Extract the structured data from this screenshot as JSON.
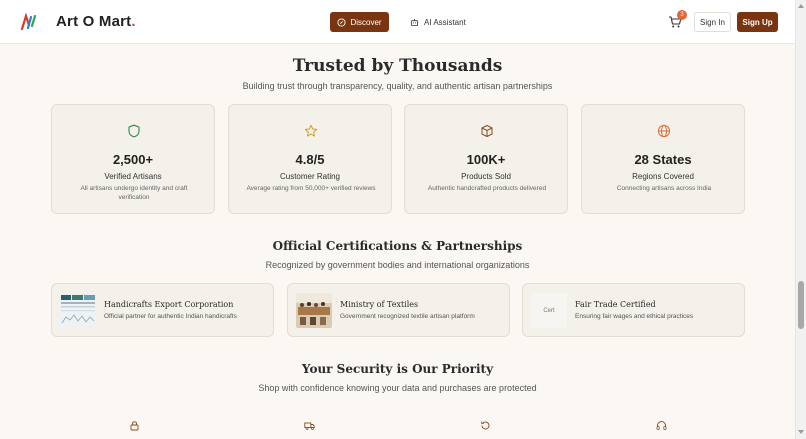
{
  "header": {
    "logo_text": "Art O Mart",
    "logo_dot": ".",
    "nav": {
      "discover_label": "Discover",
      "ai_assistant_label": "AI Assistant"
    },
    "cart_count": "3",
    "sign_in_label": "Sign In",
    "sign_up_label": "Sign Up"
  },
  "trust": {
    "title": "Trusted by Thousands",
    "subtitle": "Building trust through transparency, quality, and authentic artisan partnerships",
    "stats": [
      {
        "icon": "shield-icon",
        "value": "2,500+",
        "label": "Verified Artisans",
        "desc": "All artisans undergo identity and craft verification"
      },
      {
        "icon": "star-icon",
        "value": "4.8/5",
        "label": "Customer Rating",
        "desc": "Average rating from 50,000+ verified reviews"
      },
      {
        "icon": "package-icon",
        "value": "100K+",
        "label": "Products Sold",
        "desc": "Authentic handcrafted products delivered"
      },
      {
        "icon": "globe-icon",
        "value": "28 States",
        "label": "Regions Covered",
        "desc": "Connecting artisans across India"
      }
    ]
  },
  "certifications": {
    "title": "Official Certifications & Partnerships",
    "subtitle": "Recognized by government bodies and international organizations",
    "items": [
      {
        "title": "Handicrafts Export Corporation",
        "desc": "Official partner for authentic Indian handicrafts",
        "thumb_text": ""
      },
      {
        "title": "Ministry of Textiles",
        "desc": "Government recognized textile artisan platform",
        "thumb_text": ""
      },
      {
        "title": "Fair Trade Certified",
        "desc": "Ensuring fair wages and ethical practices",
        "thumb_text": "Cert"
      }
    ]
  },
  "security": {
    "title": "Your Security is Our Priority",
    "subtitle": "Shop with confidence knowing your data and purchases are protected",
    "icons": [
      "lock-icon",
      "truck-icon",
      "refresh-icon",
      "headphones-icon"
    ]
  },
  "colors": {
    "brand": "#7a3410",
    "accent": "#c0462b",
    "background": "#fbf8f4",
    "card": "#f4f0ea"
  }
}
